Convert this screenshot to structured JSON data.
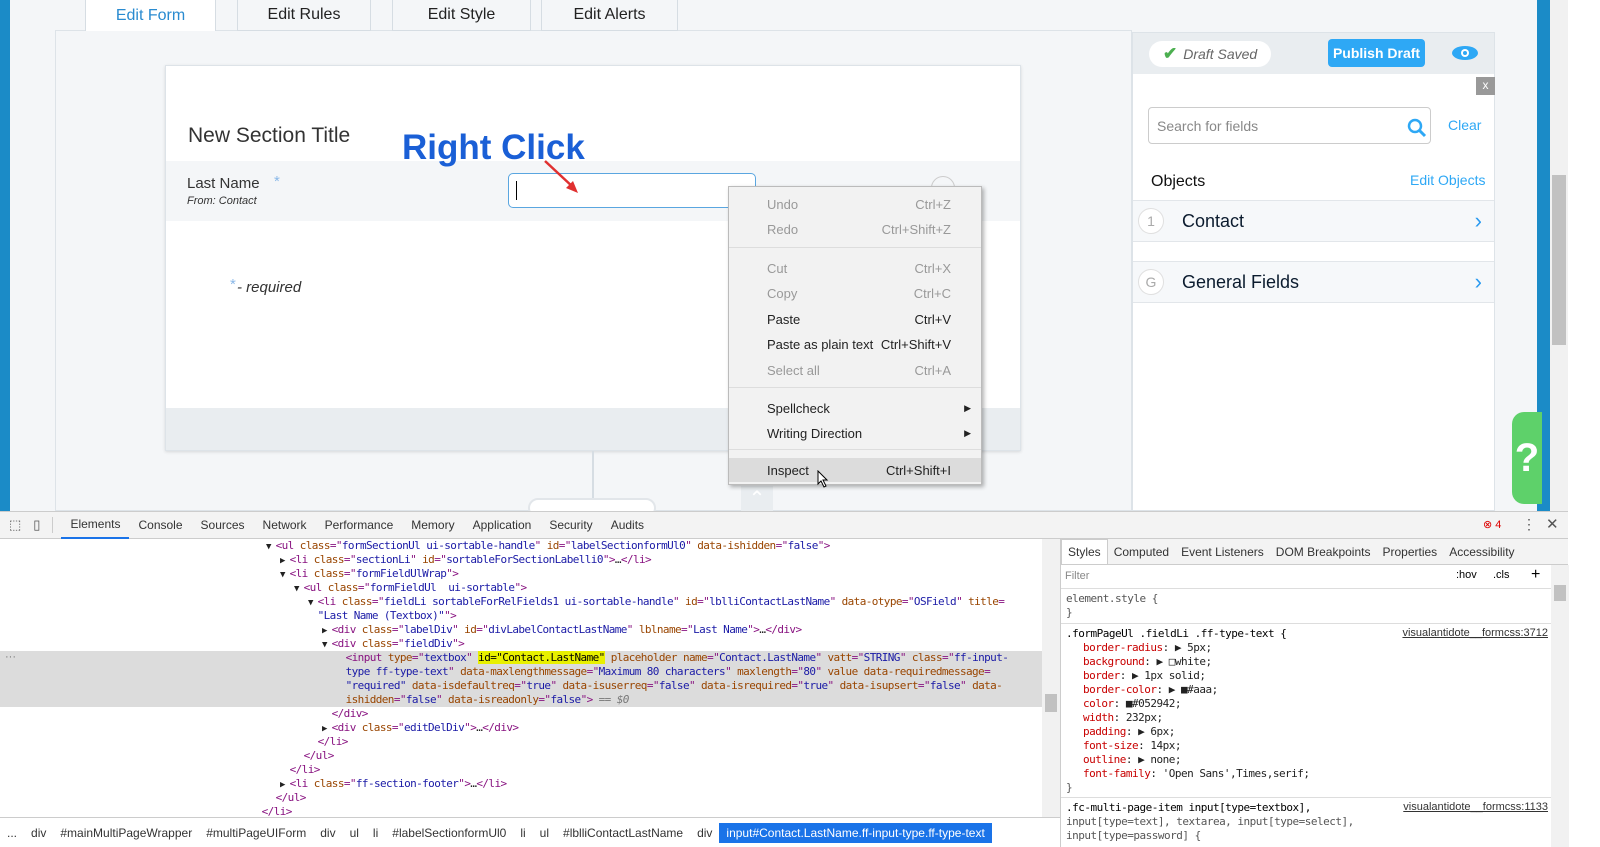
{
  "tabs": [
    "Edit Form",
    "Edit Rules",
    "Edit Style",
    "Edit Alerts"
  ],
  "form": {
    "section_title": "New Section Title",
    "field_label": "Last Name",
    "field_required_mark": "*",
    "field_source": "From: Contact",
    "required_note": "- required",
    "required_mark": "*"
  },
  "annotation": {
    "text": "Right Click",
    "color": "#1a5fd6",
    "arrow_color": "#e03030"
  },
  "context_menu": [
    {
      "label": "Undo",
      "shortcut": "Ctrl+Z",
      "disabled": true
    },
    {
      "label": "Redo",
      "shortcut": "Ctrl+Shift+Z",
      "disabled": true
    },
    {
      "label": "Cut",
      "shortcut": "Ctrl+X",
      "disabled": true
    },
    {
      "label": "Copy",
      "shortcut": "Ctrl+C",
      "disabled": true
    },
    {
      "label": "Paste",
      "shortcut": "Ctrl+V",
      "disabled": false
    },
    {
      "label": "Paste as plain text",
      "shortcut": "Ctrl+Shift+V",
      "disabled": false
    },
    {
      "label": "Select all",
      "shortcut": "Ctrl+A",
      "disabled": true
    },
    {
      "label": "Spellcheck",
      "submenu": true
    },
    {
      "label": "Writing Direction",
      "submenu": true
    },
    {
      "label": "Inspect",
      "shortcut": "Ctrl+Shift+I",
      "highlighted": true
    }
  ],
  "right_panel": {
    "draft_status": "Draft Saved",
    "publish_label": "Publish Draft",
    "close_label": "x",
    "search_placeholder": "Search for fields",
    "clear_label": "Clear",
    "objects_heading": "Objects",
    "edit_objects_label": "Edit Objects",
    "objects": [
      {
        "badge": "1",
        "name": "Contact"
      },
      {
        "badge": "G",
        "name": "General Fields"
      }
    ],
    "accent": "#2a9af0"
  },
  "help_label": "?",
  "devtools": {
    "tabs": [
      "Elements",
      "Console",
      "Sources",
      "Network",
      "Performance",
      "Memory",
      "Application",
      "Security",
      "Audits"
    ],
    "error_count": "4",
    "dom_lines": [
      {
        "i": 19,
        "t": "▼",
        "p": [
          [
            "tg",
            "<ul "
          ],
          [
            "an",
            "class"
          ],
          [
            "tg",
            "=\""
          ],
          [
            "av",
            "formSectionUl ui-sortable-handle"
          ],
          [
            "tg",
            "\" "
          ],
          [
            "an",
            "id"
          ],
          [
            "tg",
            "=\""
          ],
          [
            "av",
            "labelSectionformUl0"
          ],
          [
            "tg",
            "\" "
          ],
          [
            "an",
            "data-ishidden"
          ],
          [
            "tg",
            "=\""
          ],
          [
            "av",
            "false"
          ],
          [
            "tg",
            "\">"
          ]
        ]
      },
      {
        "i": 20,
        "t": "▶",
        "p": [
          [
            "tg",
            "<li "
          ],
          [
            "an",
            "class"
          ],
          [
            "tg",
            "=\""
          ],
          [
            "av",
            "sectionLi"
          ],
          [
            "tg",
            "\" "
          ],
          [
            "an",
            "id"
          ],
          [
            "tg",
            "=\""
          ],
          [
            "av",
            "sortableForSectionLabelli0"
          ],
          [
            "tg",
            "\">"
          ],
          [
            "tx",
            "…"
          ],
          [
            "tg",
            "</li>"
          ]
        ]
      },
      {
        "i": 20,
        "t": "▼",
        "p": [
          [
            "tg",
            "<li "
          ],
          [
            "an",
            "class"
          ],
          [
            "tg",
            "=\""
          ],
          [
            "av",
            "formFieldUlWrap"
          ],
          [
            "tg",
            "\">"
          ]
        ]
      },
      {
        "i": 21,
        "t": "▼",
        "p": [
          [
            "tg",
            "<ul "
          ],
          [
            "an",
            "class"
          ],
          [
            "tg",
            "=\""
          ],
          [
            "av",
            "formFieldUl  ui-sortable"
          ],
          [
            "tg",
            "\">"
          ]
        ]
      },
      {
        "i": 22,
        "t": "▼",
        "p": [
          [
            "tg",
            "<li "
          ],
          [
            "an",
            "class"
          ],
          [
            "tg",
            "=\""
          ],
          [
            "av",
            "fieldLi sortableForRelFields1 ui-sortable-handle"
          ],
          [
            "tg",
            "\" "
          ],
          [
            "an",
            "id"
          ],
          [
            "tg",
            "=\""
          ],
          [
            "av",
            "lblliContactLastName"
          ],
          [
            "tg",
            "\" "
          ],
          [
            "an",
            "data-otype"
          ],
          [
            "tg",
            "=\""
          ],
          [
            "av",
            "OSField"
          ],
          [
            "tg",
            "\" "
          ],
          [
            "an",
            "title"
          ],
          [
            "tg",
            "="
          ]
        ]
      },
      {
        "i": 22,
        "t": " ",
        "p": [
          [
            "av",
            "\"Last Name (Textbox)\""
          ],
          [
            "tg",
            "\">"
          ]
        ]
      },
      {
        "i": 23,
        "t": "▶",
        "p": [
          [
            "tg",
            "<div "
          ],
          [
            "an",
            "class"
          ],
          [
            "tg",
            "=\""
          ],
          [
            "av",
            "labelDiv"
          ],
          [
            "tg",
            "\" "
          ],
          [
            "an",
            "id"
          ],
          [
            "tg",
            "=\""
          ],
          [
            "av",
            "divLabelContactLastName"
          ],
          [
            "tg",
            "\" "
          ],
          [
            "an",
            "lblname"
          ],
          [
            "tg",
            "=\""
          ],
          [
            "av",
            "Last Name"
          ],
          [
            "tg",
            "\">"
          ],
          [
            "tx",
            "…"
          ],
          [
            "tg",
            "</div>"
          ]
        ]
      },
      {
        "i": 23,
        "t": "▼",
        "p": [
          [
            "tg",
            "<div "
          ],
          [
            "an",
            "class"
          ],
          [
            "tg",
            "=\""
          ],
          [
            "av",
            "fieldDiv"
          ],
          [
            "tg",
            "\">"
          ]
        ]
      },
      {
        "i": 24,
        "t": " ",
        "sel": true,
        "p": [
          [
            "tg",
            "<input "
          ],
          [
            "an",
            "type"
          ],
          [
            "tg",
            "=\""
          ],
          [
            "av",
            "textbox"
          ],
          [
            "tg",
            "\" "
          ],
          [
            "hl",
            "id=\"Contact.LastName\""
          ],
          [
            "tg",
            " "
          ],
          [
            "an",
            "placeholder name"
          ],
          [
            "tg",
            "=\""
          ],
          [
            "av",
            "Contact.LastName"
          ],
          [
            "tg",
            "\" "
          ],
          [
            "an",
            "vatt"
          ],
          [
            "tg",
            "=\""
          ],
          [
            "av",
            "STRING"
          ],
          [
            "tg",
            "\" "
          ],
          [
            "an",
            "class"
          ],
          [
            "tg",
            "=\""
          ],
          [
            "av",
            "ff-input-"
          ]
        ]
      },
      {
        "i": 24,
        "t": " ",
        "sel": true,
        "p": [
          [
            "av",
            "type ff-type-text"
          ],
          [
            "tg",
            "\" "
          ],
          [
            "an",
            "data-maxlengthmessage"
          ],
          [
            "tg",
            "=\""
          ],
          [
            "av",
            "Maximum 80 characters"
          ],
          [
            "tg",
            "\" "
          ],
          [
            "an",
            "maxlength"
          ],
          [
            "tg",
            "=\""
          ],
          [
            "av",
            "80"
          ],
          [
            "tg",
            "\" "
          ],
          [
            "an",
            "value data-requiredmessage"
          ],
          [
            "tg",
            "="
          ]
        ]
      },
      {
        "i": 24,
        "t": " ",
        "sel": true,
        "p": [
          [
            "av",
            "\"required\""
          ],
          [
            "tg",
            " "
          ],
          [
            "an",
            "data-isdefaultreq"
          ],
          [
            "tg",
            "=\""
          ],
          [
            "av",
            "true"
          ],
          [
            "tg",
            "\" "
          ],
          [
            "an",
            "data-isuserreq"
          ],
          [
            "tg",
            "=\""
          ],
          [
            "av",
            "false"
          ],
          [
            "tg",
            "\" "
          ],
          [
            "an",
            "data-isrequired"
          ],
          [
            "tg",
            "=\""
          ],
          [
            "av",
            "true"
          ],
          [
            "tg",
            "\" "
          ],
          [
            "an",
            "data-isupsert"
          ],
          [
            "tg",
            "=\""
          ],
          [
            "av",
            "false"
          ],
          [
            "tg",
            "\" "
          ],
          [
            "an",
            "data-"
          ]
        ]
      },
      {
        "i": 24,
        "t": " ",
        "sel": true,
        "p": [
          [
            "an",
            "ishidden"
          ],
          [
            "tg",
            "=\""
          ],
          [
            "av",
            "false"
          ],
          [
            "tg",
            "\" "
          ],
          [
            "an",
            "data-isreadonly"
          ],
          [
            "tg",
            "=\""
          ],
          [
            "av",
            "false"
          ],
          [
            "tg",
            "\">"
          ],
          [
            "eq",
            " == $0"
          ]
        ]
      },
      {
        "i": 23,
        "t": " ",
        "p": [
          [
            "tg",
            "</div>"
          ]
        ]
      },
      {
        "i": 23,
        "t": "▶",
        "p": [
          [
            "tg",
            "<div "
          ],
          [
            "an",
            "class"
          ],
          [
            "tg",
            "=\""
          ],
          [
            "av",
            "editDelDiv"
          ],
          [
            "tg",
            "\">"
          ],
          [
            "tx",
            "…"
          ],
          [
            "tg",
            "</div>"
          ]
        ]
      },
      {
        "i": 22,
        "t": " ",
        "p": [
          [
            "tg",
            "</li>"
          ]
        ]
      },
      {
        "i": 21,
        "t": " ",
        "p": [
          [
            "tg",
            "</ul>"
          ]
        ]
      },
      {
        "i": 20,
        "t": " ",
        "p": [
          [
            "tg",
            "</li>"
          ]
        ]
      },
      {
        "i": 20,
        "t": "▶",
        "p": [
          [
            "tg",
            "<li "
          ],
          [
            "an",
            "class"
          ],
          [
            "tg",
            "=\""
          ],
          [
            "av",
            "ff-section-footer"
          ],
          [
            "tg",
            "\">"
          ],
          [
            "tx",
            "…"
          ],
          [
            "tg",
            "</li>"
          ]
        ]
      },
      {
        "i": 19,
        "t": " ",
        "p": [
          [
            "tg",
            "</ul>"
          ]
        ]
      },
      {
        "i": 18,
        "t": " ",
        "p": [
          [
            "tg",
            "</li>"
          ]
        ]
      }
    ],
    "breadcrumbs": [
      "...",
      "div",
      "#mainMultiPageWrapper",
      "#multiPageUIForm",
      "div",
      "ul",
      "li",
      "#labelSectionformUl0",
      "li",
      "ul",
      "#lblliContactLastName",
      "div",
      "input#Contact.LastName.ff-input-type.ff-type-text"
    ],
    "styles_tabs": [
      "Styles",
      "Computed",
      "Event Listeners",
      "DOM Breakpoints",
      "Properties",
      "Accessibility"
    ],
    "filter_placeholder": "Filter",
    "hov": ":hov",
    "cls": ".cls",
    "plus": "+",
    "element_style": "element.style {",
    "close_brace": "}",
    "rule1": {
      "selector": ".formPageUl .fieldLi .ff-type-text {",
      "source": "visualantidote__formcss:3712",
      "props": [
        [
          "border-radius",
          "▶ 5px;"
        ],
        [
          "background",
          "▶ □white;"
        ],
        [
          "border",
          "▶ 1px solid;"
        ],
        [
          "border-color",
          "▶ ■#aaa;"
        ],
        [
          "color",
          "■#052942;"
        ],
        [
          "width",
          "232px;"
        ],
        [
          "padding",
          "▶ 6px;"
        ],
        [
          "font-size",
          "14px;"
        ],
        [
          "outline",
          "▶ none;"
        ],
        [
          "font-family",
          "'Open Sans',Times,serif;"
        ]
      ]
    },
    "rule2": {
      "selector": ".fc-multi-page-item input[type=textbox],",
      "line2": "input[type=text], textarea, input[type=select],",
      "line3": "input[type=password] {",
      "source": "visualantidote__formcss:1133"
    }
  }
}
